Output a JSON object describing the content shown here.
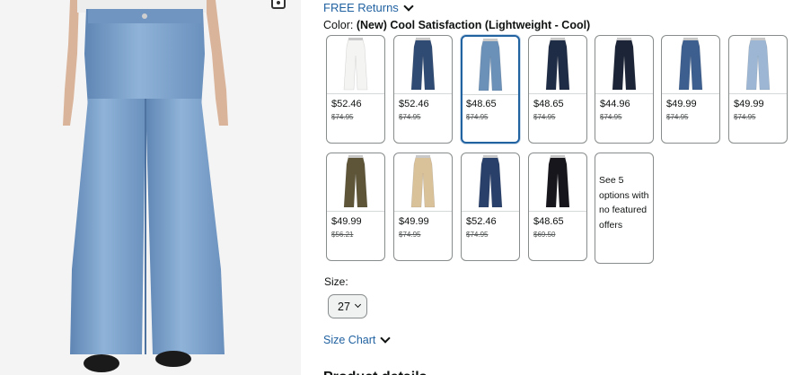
{
  "shipping": {
    "free_returns_label": "FREE Returns"
  },
  "color_selector": {
    "label": "Color:",
    "selected_value": "(New) Cool Satisfaction (Lightweight - Cool)",
    "options": [
      {
        "price": "$52.46",
        "was": "$74.95",
        "jean_color": "#f4f4f2"
      },
      {
        "price": "$52.46",
        "was": "$74.95",
        "jean_color": "#2f4a73"
      },
      {
        "price": "$48.65",
        "was": "$74.95",
        "jean_color": "#6c91b8"
      },
      {
        "price": "$48.65",
        "was": "$74.95",
        "jean_color": "#1f2c45"
      },
      {
        "price": "$44.96",
        "was": "$74.95",
        "jean_color": "#1c2538"
      },
      {
        "price": "$49.99",
        "was": "$74.95",
        "jean_color": "#3d5f8f"
      },
      {
        "price": "$49.99",
        "was": "$74.95",
        "jean_color": "#9cb6d3"
      },
      {
        "price": "$49.99",
        "was": "$56.21",
        "jean_color": "#5e5538"
      },
      {
        "price": "$49.99",
        "was": "$74.95",
        "jean_color": "#d9c19a"
      },
      {
        "price": "$52.46",
        "was": "$74.95",
        "jean_color": "#29406b"
      },
      {
        "price": "$48.65",
        "was": "$69.50",
        "jean_color": "#16161c"
      }
    ],
    "more_options_text": "See 5 options with no featured offers"
  },
  "size_selector": {
    "label": "Size:",
    "selected": "27"
  },
  "size_chart": {
    "label": "Size Chart"
  },
  "section": {
    "heading": "Product details"
  },
  "colors": {
    "link": "#2162a1",
    "selected_border": "#2162a1",
    "main_jean": "#7ea6cf"
  }
}
